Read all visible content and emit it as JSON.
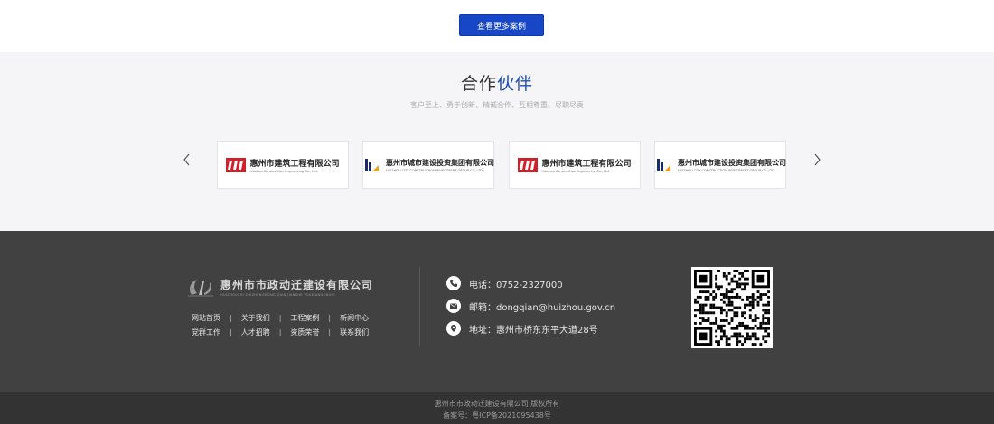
{
  "top": {
    "more_label": "查看更多案例"
  },
  "partners": {
    "title_prefix": "合作",
    "title_highlight": "伙伴",
    "subtitle": "客户至上、勇于创新、精诚合作、互相尊重、尽职尽责",
    "logos": [
      {
        "cn": "惠州市建筑工程有限公司",
        "en": "Huizhou Construction Engineering Co., Ltd."
      },
      {
        "cn": "惠州市城市建设投资集团有限公司",
        "en": "HUIZHOU CITY CONSTRUCTION INVESTMENT GROUP CO.,LTD."
      },
      {
        "cn": "惠州市建筑工程有限公司",
        "en": "Huizhou Construction Engineering Co., Ltd."
      },
      {
        "cn": "惠州市城市建设投资集团有限公司",
        "en": "HUIZHOU CITY CONSTRUCTION INVESTMENT GROUP CO.,LTD."
      }
    ]
  },
  "footer": {
    "brand_cn": "惠州市市政动迁建设有限公司",
    "brand_en": "HUIZHOUSHI SHIZHENGDONG QIAN JIANSHE YOUXIANGONGSI",
    "links_row1": [
      "网站首页",
      "关于我们",
      "工程案例",
      "新闻中心"
    ],
    "links_row2": [
      "党群工作",
      "人才招聘",
      "资质荣誉",
      "联系我们"
    ],
    "phone": "电话：0752-2327000",
    "email": "邮箱：dongqian@huizhou.gov.cn",
    "address": "地址：惠州市桥东东平大道28号"
  },
  "bottom": {
    "copyright": "惠州市市政动迁建设有限公司  版权所有",
    "icp": "备案号：粤ICP备2021095438号"
  },
  "colors": {
    "accent": "#1746c6",
    "footer_bg": "#414141",
    "bottom_bg": "#333333",
    "logo_red": "#d0202a"
  }
}
